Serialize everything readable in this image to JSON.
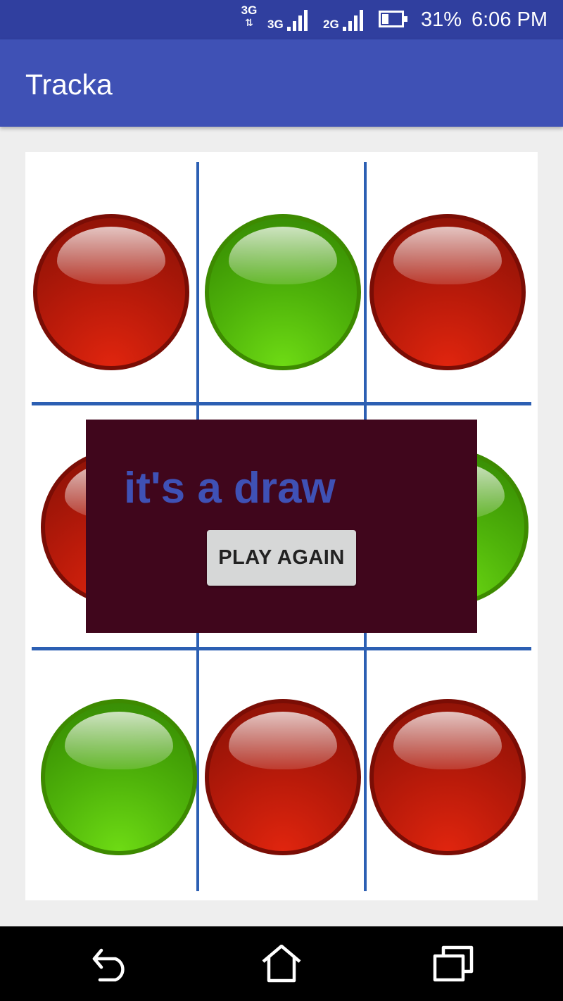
{
  "status_bar": {
    "network_type": "3G",
    "signal_1_label": "3G",
    "signal_2_label": "2G",
    "battery": "31%",
    "battery_level": 0.31,
    "time": "6:06 PM"
  },
  "app_bar": {
    "title": "Tracka"
  },
  "board": {
    "cells": [
      {
        "row": 1,
        "col": 1,
        "piece": "red"
      },
      {
        "row": 1,
        "col": 2,
        "piece": "green"
      },
      {
        "row": 1,
        "col": 3,
        "piece": "red"
      },
      {
        "row": 2,
        "col": 1,
        "piece": "red"
      },
      {
        "row": 2,
        "col": 2,
        "piece": "hidden"
      },
      {
        "row": 2,
        "col": 3,
        "piece": "green"
      },
      {
        "row": 3,
        "col": 1,
        "piece": "green"
      },
      {
        "row": 3,
        "col": 2,
        "piece": "red"
      },
      {
        "row": 3,
        "col": 3,
        "piece": "red"
      }
    ],
    "line_color": "#2c5fb3"
  },
  "dialog": {
    "message": "it's a draw",
    "button_label": "PLAY AGAIN",
    "background_color": "#40061c",
    "message_color": "#3f51b5"
  },
  "nav_bar": {
    "icons": [
      "back-icon",
      "home-icon",
      "recent-apps-icon"
    ]
  },
  "colors": {
    "status_bar": "#303f9f",
    "app_bar": "#3f51b5",
    "background": "#eeeeee"
  }
}
